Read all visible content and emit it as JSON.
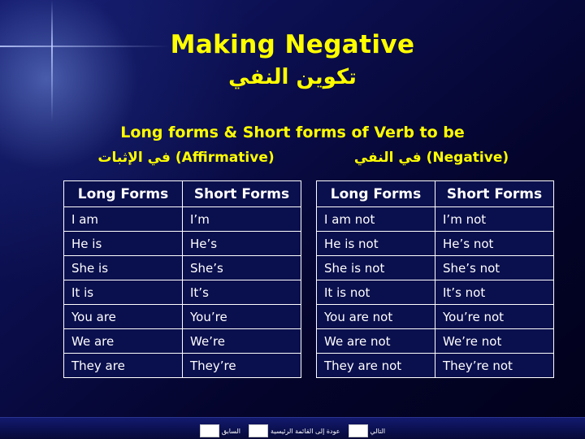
{
  "slide": {
    "title_en": "Making Negative",
    "title_ar": "ﺗﻜﻮﻳﻦ ﺍﻟﻨﻔﻲ",
    "subtitle": "Long forms & Short forms of Verb to be",
    "column_heading_affirmative": "(Affirmative) ﻓﻲ ﺍﻹﺛﺒﺎﺕ",
    "column_heading_negative": "(Negative) ﻓﻲ ﺍﻟﻨﻔﻲ",
    "affirmative_table": {
      "headers": [
        "Long Forms",
        "Short Forms"
      ],
      "rows": [
        [
          "I am",
          "I’m"
        ],
        [
          "He is",
          "He’s"
        ],
        [
          "She is",
          "She’s"
        ],
        [
          "It is",
          "It’s"
        ],
        [
          "You are",
          "You’re"
        ],
        [
          "We are",
          "We’re"
        ],
        [
          "They are",
          "They’re"
        ]
      ]
    },
    "negative_table": {
      "headers": [
        "Long Forms",
        "Short Forms"
      ],
      "rows": [
        [
          "I am not",
          "I’m not"
        ],
        [
          "He is not",
          "He’s not"
        ],
        [
          "She is not",
          "She’s not"
        ],
        [
          "It is not",
          "It’s not"
        ],
        [
          "You are not",
          "You’re not"
        ],
        [
          "We are not",
          "We’re not"
        ],
        [
          "They are not",
          "They’re not"
        ]
      ]
    },
    "footer": {
      "nav_next_label": "ﺍﻟﺘﺎﻟﻲ",
      "nav_home_label": "ﻋﻮﺩﺓ ﺇﻟﻰ ﺍﻟﻘﺎﺋﻤﺔ ﺍﻟﺮﺋﻴﺴﻴﺔ",
      "nav_prev_label": "ﺍﻟﺴﺎﺑﻖ"
    },
    "colors": {
      "accent_text": "#ffff00",
      "body_text": "#ffffff",
      "background": "#000033"
    }
  }
}
